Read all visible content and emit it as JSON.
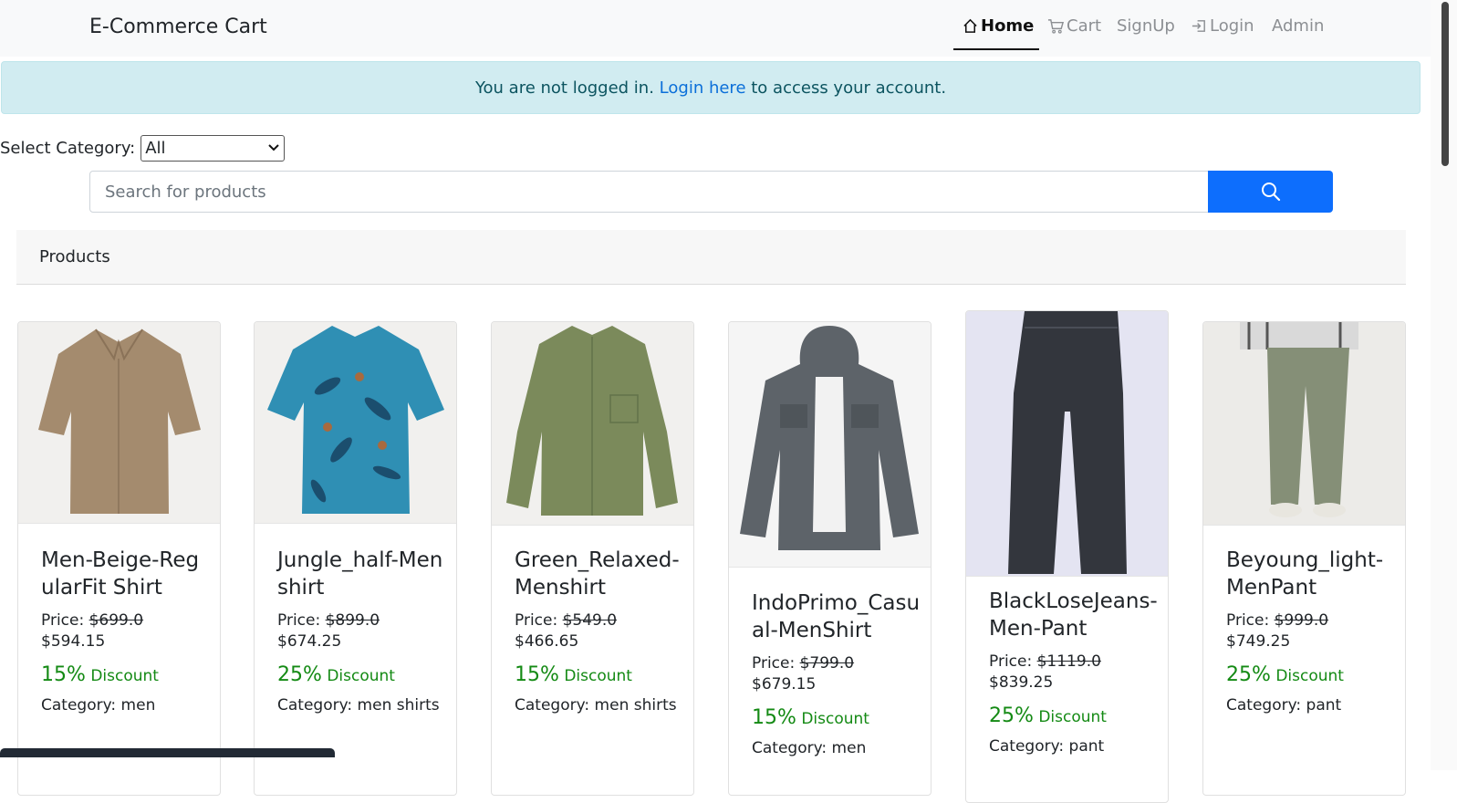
{
  "brand": "E-Commerce Cart",
  "nav": {
    "home": "Home",
    "cart": "Cart",
    "signup": "SignUp",
    "login": "Login",
    "admin": "Admin"
  },
  "alert": {
    "before": "You are not logged in.",
    "link": "Login here",
    "after": "to access your account."
  },
  "category": {
    "label": "Select Category:",
    "selected": "All"
  },
  "search": {
    "placeholder": "Search for products"
  },
  "products_header": "Products",
  "products": [
    {
      "name": "Men-Beige-RegularFit Shirt",
      "price_label": "Price:",
      "old_price": "$699.0",
      "new_price": "$594.15",
      "pct": "15%",
      "disc_label": "Discount",
      "category": "Category: men"
    },
    {
      "name": "Jungle_half-Menshirt",
      "price_label": "Price:",
      "old_price": "$899.0",
      "new_price": "$674.25",
      "pct": "25%",
      "disc_label": "Discount",
      "category": "Category: men shirts"
    },
    {
      "name": "Green_Relaxed-Menshirt",
      "price_label": "Price:",
      "old_price": "$549.0",
      "new_price": "$466.65",
      "pct": "15%",
      "disc_label": "Discount",
      "category": "Category: men shirts"
    },
    {
      "name": "IndoPrimo_Casual-MenShirt",
      "price_label": "Price:",
      "old_price": "$799.0",
      "new_price": "$679.15",
      "pct": "15%",
      "disc_label": "Discount",
      "category": "Category: men"
    },
    {
      "name": "BlackLoseJeans-Men-Pant",
      "price_label": "Price:",
      "old_price": "$1119.0",
      "new_price": "$839.25",
      "pct": "25%",
      "disc_label": "Discount",
      "category": "Category: pant"
    },
    {
      "name": "Beyoung_light-MenPant",
      "price_label": "Price:",
      "old_price": "$999.0",
      "new_price": "$749.25",
      "pct": "25%",
      "disc_label": "Discount",
      "category": "Category: pant"
    }
  ],
  "colors": {
    "primary": "#0d6efd",
    "discount": "#148a14",
    "alert_bg": "#d1ecf1"
  }
}
